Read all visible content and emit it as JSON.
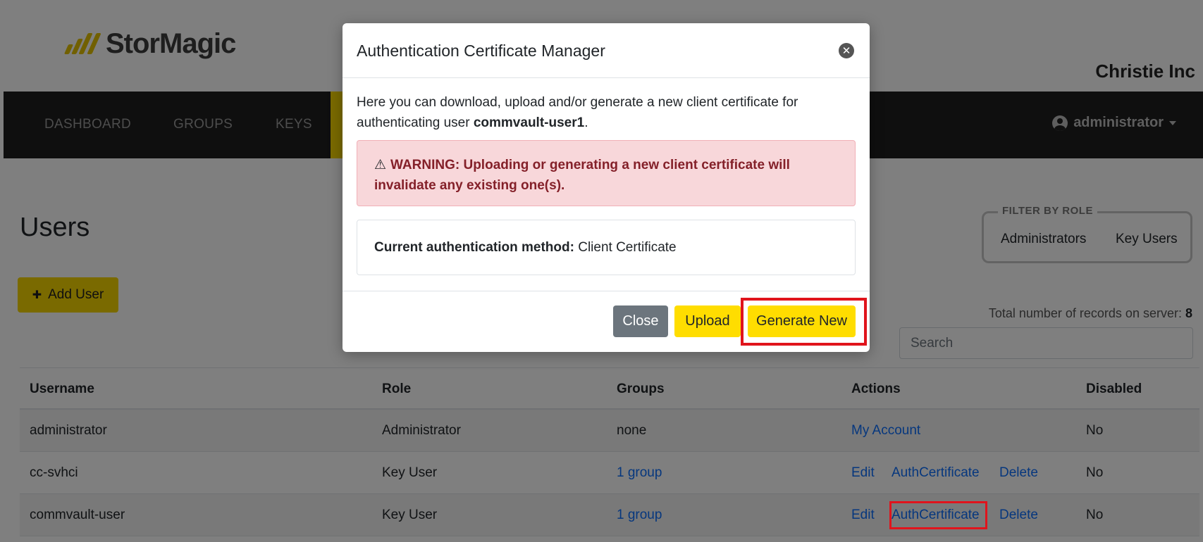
{
  "brand": {
    "name": "StorMagic",
    "accent": "#e3c000"
  },
  "org_name": "Christie Inc",
  "nav": {
    "items": [
      "DASHBOARD",
      "GROUPS",
      "KEYS"
    ],
    "user": "administrator"
  },
  "page": {
    "title": "Users",
    "add_user_label": "Add User",
    "add_user_icon": "user-plus-icon",
    "filter": {
      "legend": "FILTER BY ROLE",
      "options": [
        "Administrators",
        "Key Users"
      ]
    },
    "records_label": "Total number of records on server:",
    "records_count": "8",
    "search_placeholder": "Search"
  },
  "table": {
    "headers": [
      "Username",
      "Role",
      "Groups",
      "Actions",
      "Disabled"
    ],
    "rows": [
      {
        "username": "administrator",
        "role": "Administrator",
        "groups": "none",
        "actions": [
          "My Account"
        ],
        "disabled": "No"
      },
      {
        "username": "cc-svhci",
        "role": "Key User",
        "groups": "1 group",
        "actions": [
          "Edit",
          "AuthCertificate",
          "Delete"
        ],
        "disabled": "No"
      },
      {
        "username": "commvault-user",
        "role": "Key User",
        "groups": "1 group",
        "actions": [
          "Edit",
          "AuthCertificate",
          "Delete"
        ],
        "disabled": "No"
      }
    ]
  },
  "modal": {
    "title": "Authentication Certificate Manager",
    "intro_text": "Here you can download, upload and/or generate a new client certificate for authenticating user ",
    "intro_user": "commvault-user1",
    "intro_end": ".",
    "warning_icon": "warning-triangle-icon",
    "warning": "WARNING: Uploading or generating a new client certificate will invalidate any existing one(s).",
    "method_label": "Current authentication method:",
    "method_value": "Client Certificate",
    "buttons": {
      "close": "Close",
      "upload": "Upload",
      "generate": "Generate New"
    }
  },
  "colors": {
    "primary_yellow": "#ffdd00",
    "nav_bg": "#1e1e1e",
    "highlight_red": "#e0141c",
    "alert_bg": "#f8d7da",
    "alert_text": "#842029"
  }
}
